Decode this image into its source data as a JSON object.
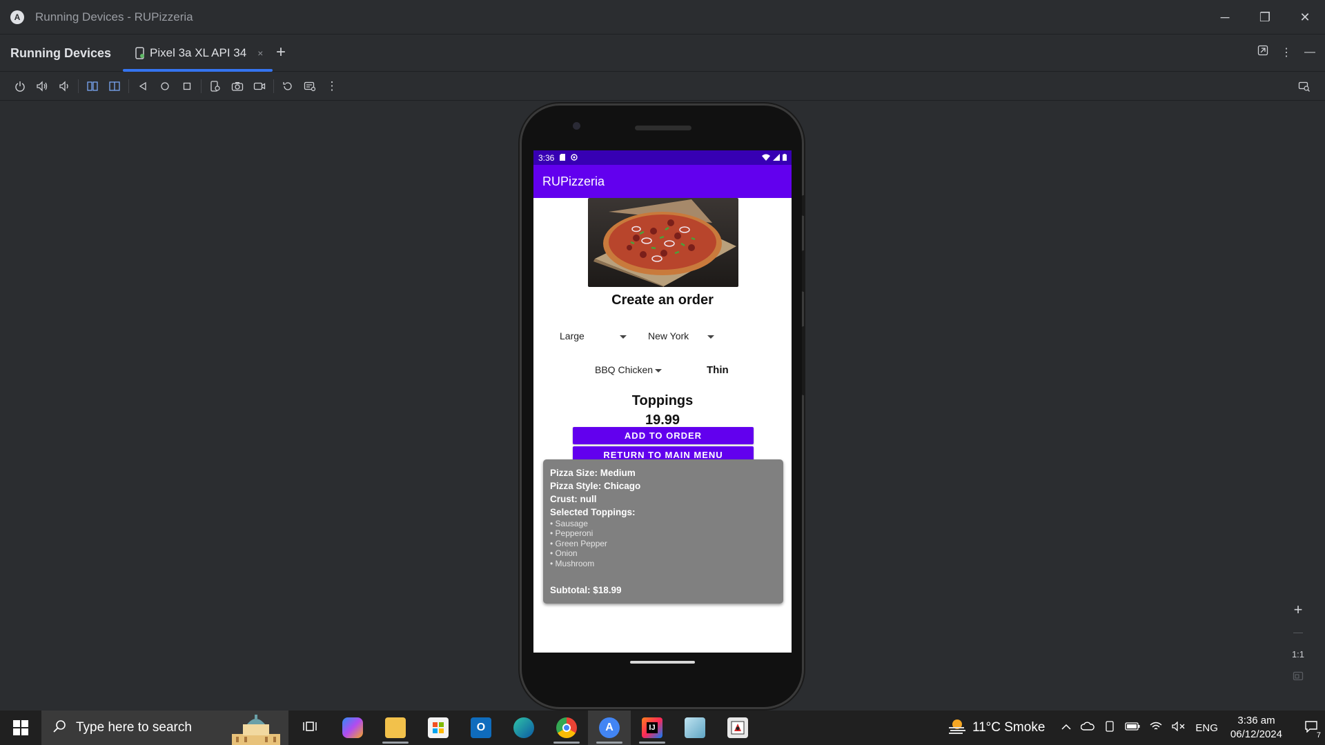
{
  "window": {
    "title": "Running Devices - RUPizzeria",
    "minimize": "─",
    "restore": "❐",
    "close": "✕"
  },
  "toolwindow": {
    "title": "Running Devices",
    "tab_label": "Pixel 3a XL API 34",
    "tab_close": "×",
    "add_tab": "+"
  },
  "phone": {
    "status_time": "3:36",
    "app_title": "RUPizzeria",
    "screen_title": "Create an order",
    "size_selected": "Large",
    "style_selected": "New York",
    "pizza_selected": "BBQ Chicken",
    "crust": "Thin",
    "toppings_title": "Toppings",
    "price": "19.99",
    "add_button": "ADD TO ORDER",
    "return_button": "RETURN TO MAIN MENU",
    "summary": {
      "size": "Pizza Size: Medium",
      "style": "Pizza Style: Chicago",
      "crust": "Crust: null",
      "toppings_header": "Selected Toppings:",
      "toppings": [
        "• Sausage",
        "• Pepperoni",
        "• Green Pepper",
        "• Onion",
        "• Mushroom"
      ],
      "subtotal": "Subtotal: $18.99"
    }
  },
  "zoom": {
    "zoom_in": "+",
    "zoom_out": "—",
    "actual_size": "1:1"
  },
  "taskbar": {
    "search_placeholder": "Type here to search",
    "weather": "11°C  Smoke",
    "language": "ENG",
    "time": "3:36 am",
    "date": "06/12/2024",
    "notification_count": "7"
  }
}
